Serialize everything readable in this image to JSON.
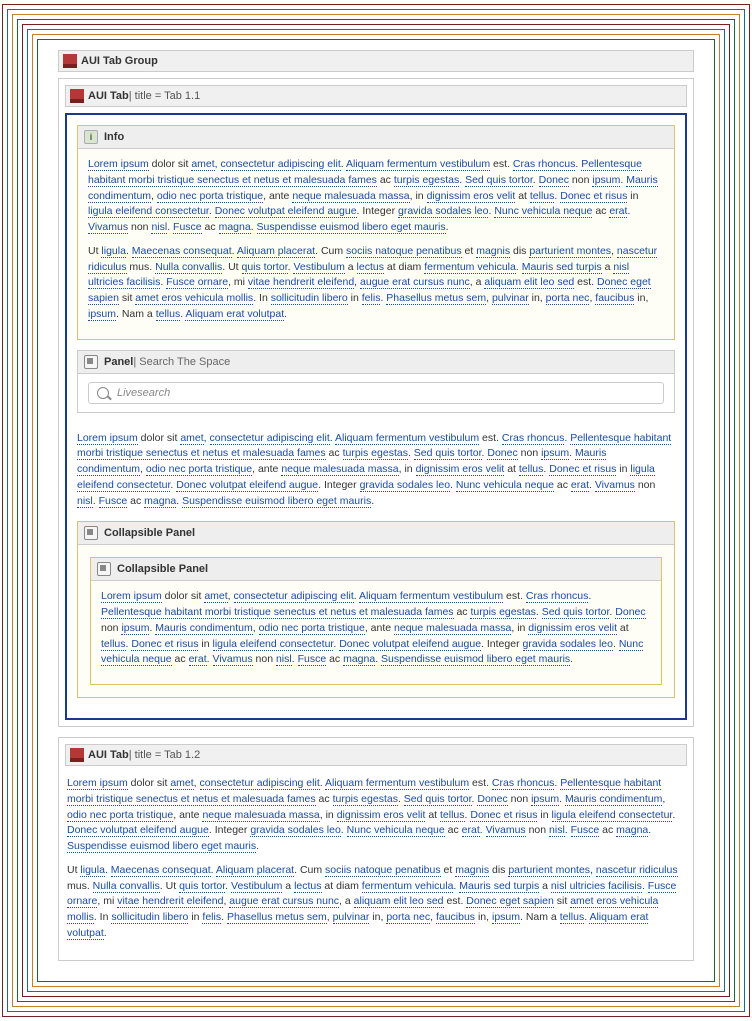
{
  "tabGroup": {
    "title": "AUI Tab Group"
  },
  "tabs": [
    {
      "labelPrefix": "AUI Tab",
      "titleText": " | title = Tab 1.1"
    },
    {
      "labelPrefix": "AUI Tab",
      "titleText": " | title = Tab 1.2"
    }
  ],
  "panels": {
    "info": {
      "title": "Info"
    },
    "search": {
      "titleBold": "Panel",
      "titleThin": " | Search The Space",
      "placeholder": "Livesearch"
    },
    "collapsible": {
      "outerTitle": "Collapsible Panel",
      "innerTitle": "Collapsible Panel"
    }
  },
  "para1_html": "<span class='linky'>Lorem ipsum</span> dolor sit <span class='linky'>amet</span>, <span class='linky'>consectetur adipiscing elit</span>. <span class='linky'>Aliquam fermentum vestibulum</span> est. <span class='linky'>Cras rhoncus</span>. <span class='linky'>Pellentesque habitant morbi tristique senectus et netus et malesuada fames</span> ac <span class='linky'>turpis egestas</span>. <span class='linky'>Sed quis tortor</span>. <span class='linky'>Donec</span> non <span class='linky'>ipsum</span>. <span class='linky'>Mauris condimentum</span>, <span class='linky'>odio nec porta tristique</span>, ante <span class='linky'>neque malesuada massa</span>, in <span class='linky'>dignissim eros velit</span> at <span class='linky'>tellus</span>. <span class='linky'>Donec et risus</span> in <span class='linky'>ligula eleifend consectetur</span>. <span class='linky'>Donec volutpat eleifend augue</span>. Integer <span class='linky'>gravida sodales leo</span>. <span class='linky'>Nunc vehicula neque</span> ac <span class='linky'>erat</span>. <span class='linky'>Vivamus</span> non <span class='linky'>nisl</span>. <span class='linky'>Fusce</span> ac <span class='linky'>magna</span>. <span class='linky'>Suspendisse euismod libero eget mauris</span>.",
  "para2_html": "Ut <span class='linky'>ligula</span>. <span class='linky'>Maecenas consequat</span>. <span class='linky'>Aliquam placerat</span>. Cum <span class='linky'>sociis natoque penatibus</span> et <span class='linky'>magnis</span> dis <span class='linky'>parturient montes</span>, <span class='linky'>nascetur ridiculus</span> mus. <span class='linky'>Nulla convallis</span>. Ut <span class='linky'>quis tortor</span>. <span class='linky'>Vestibulum</span> a <span class='linky'>lectus</span> at diam <span class='linky'>fermentum vehicula</span>. <span class='linky'>Mauris sed turpis</span> a <span class='linky'>nisl ultricies facilisis</span>. <span class='linky'>Fusce ornare</span>, mi <span class='linky'>vitae hendrerit eleifend</span>, <span class='linky'>augue erat cursus nunc</span>, a <span class='linky'>aliquam elit leo sed</span> est. <span class='linky'>Donec eget sapien</span> sit <span class='linky'>amet eros vehicula mollis</span>. In <span class='linky'>sollicitudin libero</span> in <span class='linky'>felis</span>. <span class='linky'>Phasellus metus sem</span>, <span class='linky'>pulvinar</span> in, <span class='linky'>porta nec</span>, <span class='linky'>faucibus</span> in, <span class='linky'>ipsum</span>. Nam a <span class='linky'>tellus</span>. <span class='linky'>Aliquam erat volutpat</span>."
}
